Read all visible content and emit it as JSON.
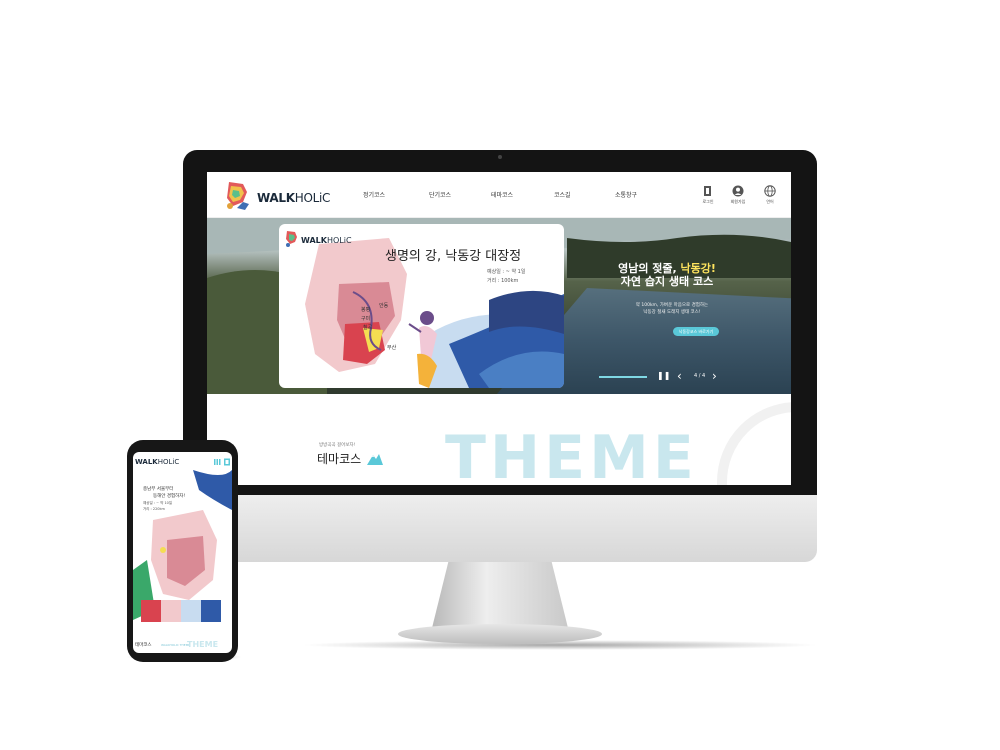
{
  "site": {
    "logo": {
      "bold": "WALK",
      "light": "HOLiC"
    }
  },
  "nav": {
    "items": [
      "정기코스",
      "단기코스",
      "테마코스",
      "코스길",
      "소통창구"
    ]
  },
  "utility": {
    "login": "로그인",
    "signup": "회원가입",
    "language": "언어"
  },
  "hero": {
    "card": {
      "logo_bold": "WALK",
      "logo_light": "HOLiC",
      "title": "생명의 강, 낙동강 대장정",
      "meta_period": "예상일 : ~ 약 1일",
      "meta_distance": "거리 : 100km",
      "map_labels": [
        "안동",
        "봉평",
        "구미",
        "칠곡",
        "부산"
      ]
    },
    "headline_line1_a": "영남의 젖줄, ",
    "headline_line1_b": "낙동강!",
    "headline_line2": "자연 습지 생태 코스",
    "desc_line1": "약 100km, 가벼운 마음으로 경험하는",
    "desc_line2": "낙동강 철새 도래지 생태 코스!",
    "button": "낙동강코스 바로가기",
    "slide_counter": "4 / 4",
    "pause_symbol": "❚❚",
    "prev_symbol": "‹",
    "next_symbol": "›",
    "progress": 1.0
  },
  "theme": {
    "subtitle": "방방곡곡 걸어보자!",
    "title": "테마코스",
    "big_text": "THEME"
  },
  "phone": {
    "logo_bold": "WALK",
    "logo_light": "HOLiC",
    "text_line1": "충남부 서울부터",
    "text_line2": "동해안 경험하자!",
    "meta_period": "예상일 : ~ 약 10일",
    "meta_distance": "거리 : 220km",
    "bottom_title": "테마코스",
    "bottom_sub": "WALKHOLIC THEME",
    "bottom_big": "THEME"
  },
  "colors": {
    "accent": "#5ac8d8",
    "highlight": "#ffe45e",
    "theme_text": "#c9e7ee",
    "brand_dark": "#1b2a3a"
  },
  "icons": [
    "login-icon",
    "user-icon",
    "globe-icon",
    "pause-icon",
    "prev-icon",
    "next-icon",
    "mountain-icon",
    "menu-icon"
  ]
}
